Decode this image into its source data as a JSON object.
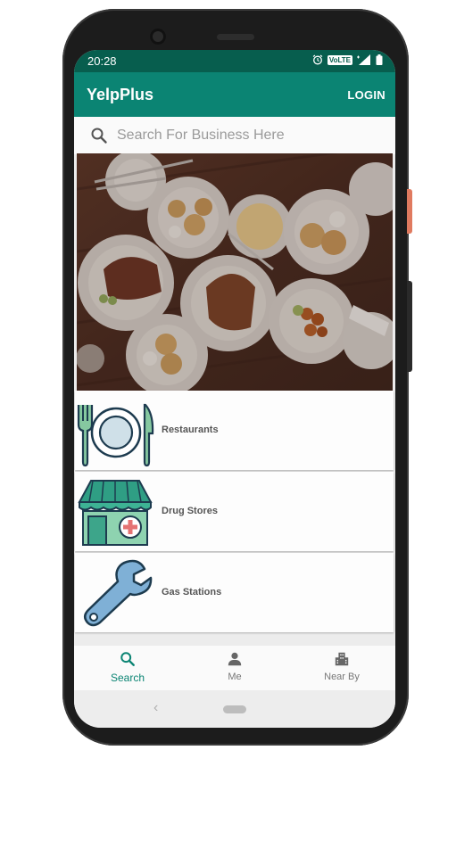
{
  "status": {
    "time": "20:28",
    "volte": "VoLTE"
  },
  "appbar": {
    "title": "YelpPlus",
    "login_label": "LOGIN"
  },
  "search": {
    "placeholder": "Search For Business Here"
  },
  "categories": [
    {
      "label": "Restaurants",
      "icon": "restaurant-icon"
    },
    {
      "label": "Drug Stores",
      "icon": "drug-store-icon"
    },
    {
      "label": "Gas Stations",
      "icon": "wrench-icon"
    }
  ],
  "bottom_nav": [
    {
      "label": "Search",
      "icon": "search-icon",
      "active": true
    },
    {
      "label": "Me",
      "icon": "person-icon",
      "active": false
    },
    {
      "label": "Near By",
      "icon": "city-icon",
      "active": false
    }
  ],
  "colors": {
    "primary": "#0b8473",
    "status_bar": "#075e4e",
    "accent_red": "#e57373"
  }
}
